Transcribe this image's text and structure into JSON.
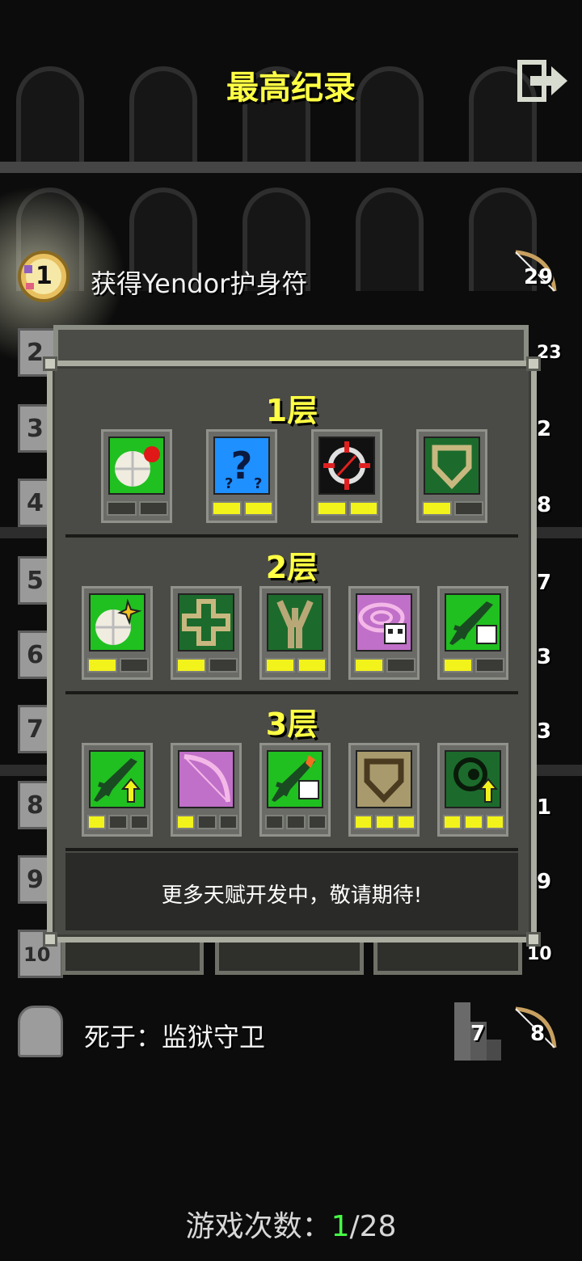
{
  "header": {
    "title": "最高纪录",
    "exit_icon": "exit-icon"
  },
  "records": {
    "top_entry": {
      "rank": "1",
      "description": "获得Yendor护身符",
      "score": "29"
    },
    "ranks_behind": [
      "2",
      "3",
      "4",
      "5",
      "6",
      "7",
      "8",
      "9",
      "10"
    ],
    "scores_behind": [
      "23",
      "2",
      "8",
      "7",
      "3",
      "3",
      "1",
      "9",
      "10"
    ],
    "last_entry": {
      "description": "死于：监狱守卫",
      "depth": "7",
      "score": "8"
    }
  },
  "talents": {
    "tiers": [
      {
        "title": "1层",
        "items": [
          {
            "icon": "food-plate-icon",
            "bg": "#20c020",
            "points": [
              0,
              0
            ]
          },
          {
            "icon": "question-mark-icon",
            "bg": "#1e90ff",
            "points": [
              1,
              1
            ]
          },
          {
            "icon": "crosshair-icon",
            "bg": "#111111",
            "points": [
              1,
              1
            ]
          },
          {
            "icon": "shield-outline-icon",
            "bg": "#1c6b2c",
            "points": [
              1,
              0
            ]
          }
        ]
      },
      {
        "title": "2层",
        "items": [
          {
            "icon": "plate-sparkle-icon",
            "bg": "#20c020",
            "points": [
              1,
              0
            ]
          },
          {
            "icon": "healing-cross-icon",
            "bg": "#1c6b2c",
            "points": [
              1,
              0
            ]
          },
          {
            "icon": "tree-root-icon",
            "bg": "#1c6b2c",
            "points": [
              1,
              1
            ]
          },
          {
            "icon": "skull-swirl-icon",
            "bg": "#c070c8",
            "points": [
              1,
              0
            ]
          },
          {
            "icon": "dart-skull-icon",
            "bg": "#20c020",
            "points": [
              1,
              0
            ]
          }
        ]
      },
      {
        "title": "3层",
        "items": [
          {
            "icon": "dart-up-icon",
            "bg": "#20c020",
            "points": [
              1,
              0,
              0
            ]
          },
          {
            "icon": "bow-icon",
            "bg": "#c070c8",
            "points": [
              1,
              0,
              0
            ]
          },
          {
            "icon": "dart-fire-icon",
            "bg": "#20c020",
            "points": [
              0,
              0,
              0
            ]
          },
          {
            "icon": "shield-tan-icon",
            "bg": "#a89a6c",
            "points": [
              1,
              1,
              1
            ]
          },
          {
            "icon": "eye-up-icon",
            "bg": "#1c6b2c",
            "points": [
              1,
              1,
              1
            ]
          }
        ]
      }
    ],
    "footer": "更多天赋开发中，敬请期待!"
  },
  "games": {
    "label": "游戏次数：",
    "current": "1",
    "total": "/28"
  }
}
